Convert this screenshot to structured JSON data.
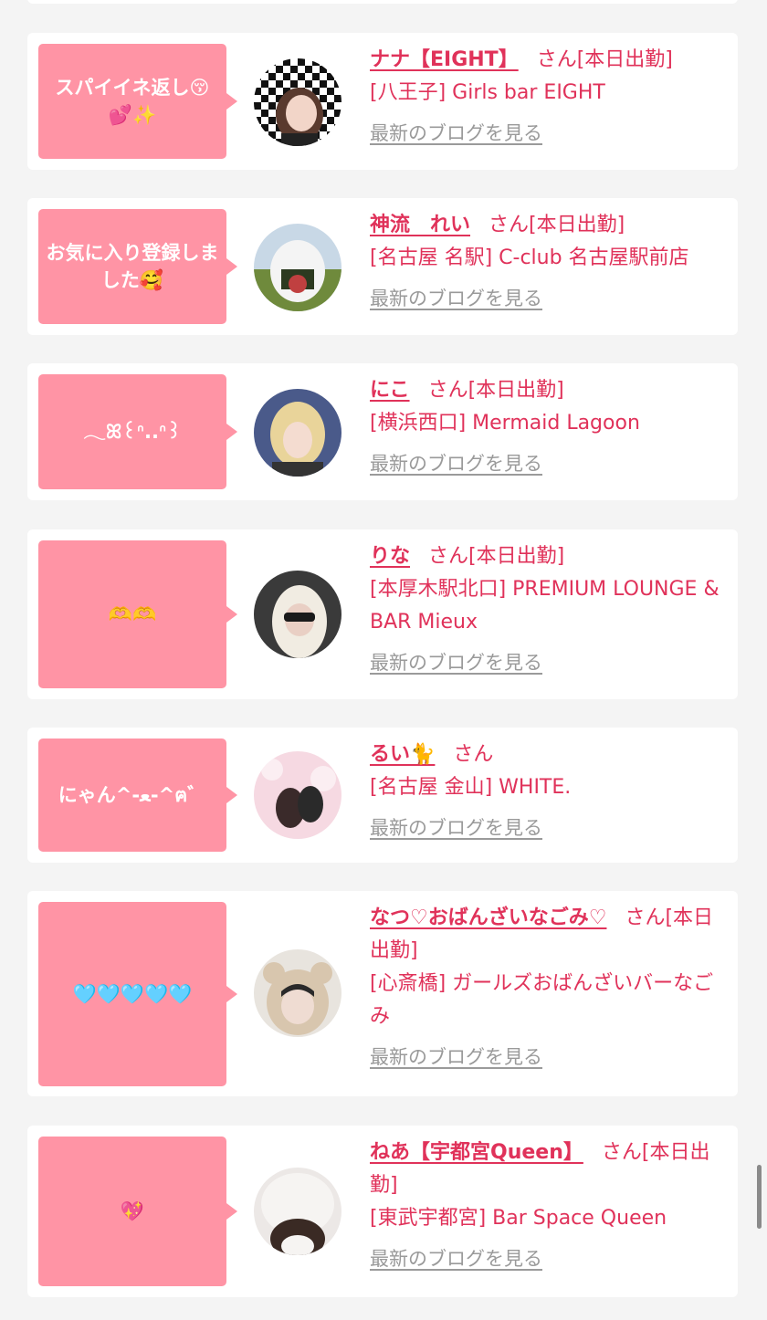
{
  "entries": [
    {
      "comment": "スパイイネ返し😚💕✨",
      "name": "ナナ【EIGHT】",
      "suffix": "さん[本日出勤]",
      "shop": "[八王子] Girls bar EIGHT",
      "blog": "最新のブログを見る"
    },
    {
      "comment": "お気に入り登録しました🥰",
      "name": "神流　れい",
      "suffix": "さん[本日出勤]",
      "shop": "[名古屋 名駅] C-club 名古屋駅前店",
      "blog": "最新のブログを見る"
    },
    {
      "comment": "𓂃ꕤ꒰ᐢ..ᐢ꒱",
      "name": "にこ",
      "suffix": "さん[本日出勤]",
      "shop": "[横浜西口] Mermaid Lagoon",
      "blog": "最新のブログを見る"
    },
    {
      "comment": "🫶🫶",
      "name": "りな",
      "suffix": "さん[本日出勤]",
      "shop": "[本厚木駅北口] PREMIUM LOUNGE & BAR Mieux",
      "blog": "最新のブログを見る"
    },
    {
      "comment": "にゃん^-ﻌ-^ฅ゛",
      "name": "るい🐈",
      "suffix": "さん",
      "shop": "[名古屋 金山] WHITE.",
      "blog": "最新のブログを見る"
    },
    {
      "comment": "🩵🩵🩵🩵🩵",
      "name": "なつ♡おばんざいなごみ♡",
      "suffix": "さん[本日出勤]",
      "shop": "[心斎橋] ガールズおばんざいバーなごみ",
      "blog": "最新のブログを見る"
    },
    {
      "comment": "💖",
      "name": "ねあ【宇都宮Queen】",
      "suffix": "さん[本日出勤]",
      "shop": "[東武宇都宮] Bar Space Queen",
      "blog": "最新のブログを見る"
    }
  ],
  "colors": {
    "bubble": "#ff94a5",
    "accent": "#e0325a",
    "link_gray": "#9a9a9a",
    "background": "#f4f4f4"
  }
}
